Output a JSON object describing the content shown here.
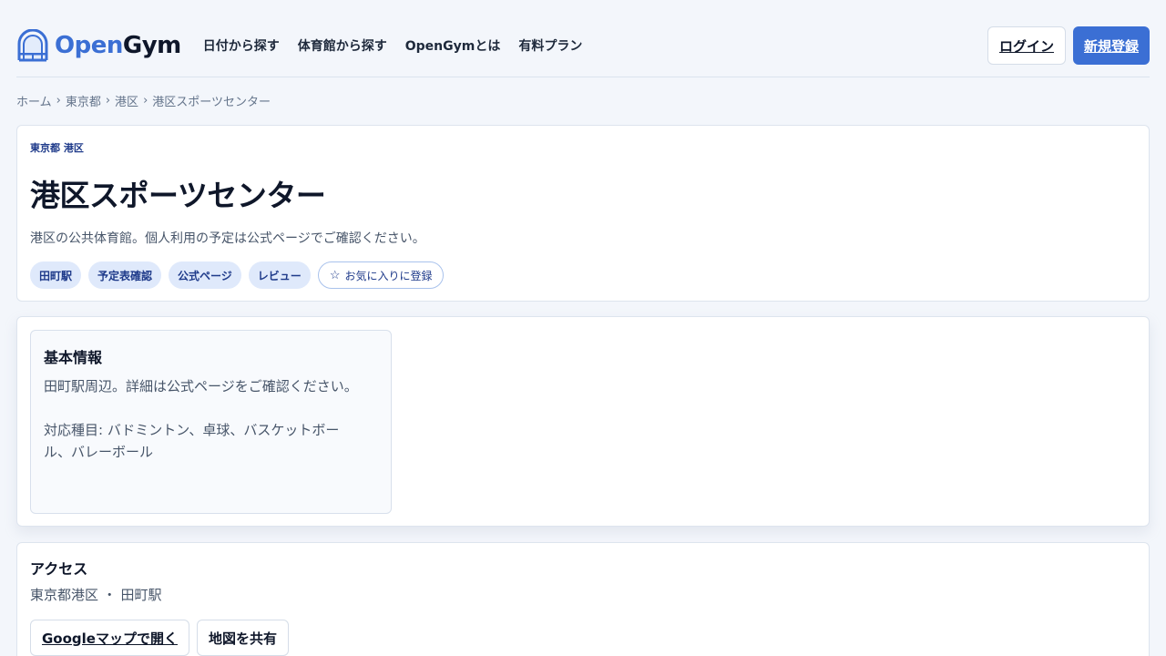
{
  "header": {
    "logo": {
      "open": "Open",
      "gym": "Gym"
    },
    "nav": [
      {
        "label": "日付から探す"
      },
      {
        "label": "体育館から探す"
      },
      {
        "label": "OpenGymとは"
      },
      {
        "label": "有料プラン"
      }
    ],
    "login_label": "ログイン",
    "register_label": "新規登録"
  },
  "breadcrumb": {
    "items": [
      "ホーム",
      "東京都",
      "港区",
      "港区スポーツセンター"
    ],
    "separator": "›"
  },
  "facility": {
    "region": "東京都 港区",
    "name": "港区スポーツセンター",
    "description": "港区の公共体育館。個人利用の予定は公式ページでご確認ください。",
    "chips": [
      "田町駅",
      "予定表確認",
      "公式ページ",
      "レビュー"
    ],
    "favorite": {
      "icon": "star-icon",
      "star": "☆",
      "label": "お気に入りに登録"
    }
  },
  "info": {
    "title": "基本情報",
    "line1": "田町駅周辺。詳細は公式ページをご確認ください。",
    "line2": "対応種目: バドミントン、卓球、バスケットボール、バレーボール"
  },
  "access": {
    "title": "アクセス",
    "address": "東京都港区 ・ 田町駅",
    "map_button": "Googleマップで開く",
    "share_button": "地図を共有"
  },
  "colors": {
    "brand": "#3b6fd4",
    "chip_bg": "#dfe9fb",
    "chip_text": "#1e3a8a",
    "page_bg": "#f3f6fb"
  }
}
